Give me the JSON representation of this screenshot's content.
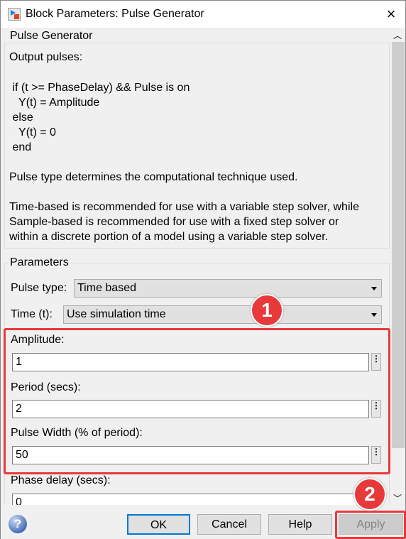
{
  "window": {
    "title": "Block Parameters: Pulse Generator"
  },
  "description": {
    "group_title": "Pulse Generator",
    "lines": [
      "Output pulses:",
      " if (t >= PhaseDelay) && Pulse is on",
      "   Y(t) = Amplitude",
      " else",
      "   Y(t) = 0",
      " end",
      "Pulse type determines the computational technique used.",
      "Time-based is recommended for use with a variable step solver, while",
      "Sample-based is recommended for use with a fixed step solver or",
      "within a discrete portion of a model using a variable step solver."
    ]
  },
  "parameters": {
    "group_title": "Parameters",
    "pulse_type": {
      "label": "Pulse type:",
      "value": "Time based"
    },
    "time": {
      "label": "Time (t):",
      "value": "Use simulation time"
    },
    "amplitude": {
      "label": "Amplitude:",
      "value": "1"
    },
    "period": {
      "label": "Period (secs):",
      "value": "2"
    },
    "pulse_width": {
      "label": "Pulse Width (% of period):",
      "value": "50"
    },
    "phase_delay": {
      "label": "Phase delay (secs):",
      "value": "0"
    },
    "more_glyph": "⋮"
  },
  "buttons": {
    "ok": "OK",
    "cancel": "Cancel",
    "help": "Help",
    "apply": "Apply",
    "help_icon": "?"
  },
  "annotations": {
    "badge1": "1",
    "badge2": "2",
    "color": "#e8393a"
  },
  "icons": {
    "close": "×"
  }
}
